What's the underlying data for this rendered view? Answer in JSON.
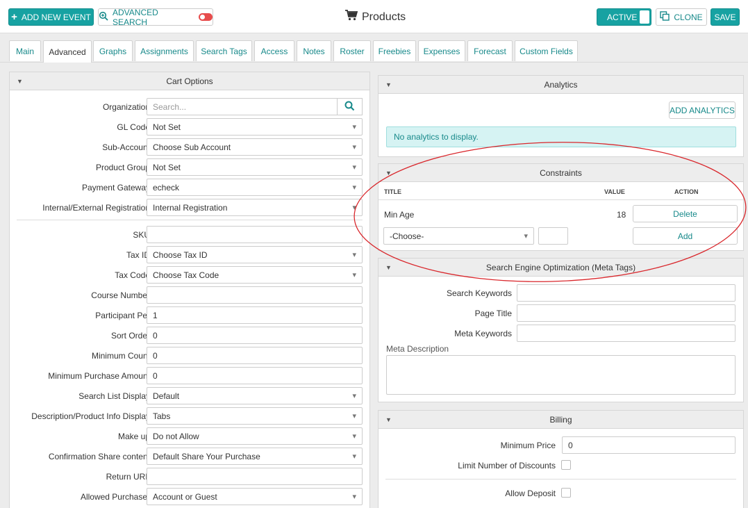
{
  "header": {
    "add_event": "ADD NEW EVENT",
    "advanced_search": "ADVANCED SEARCH",
    "title": "Products",
    "active": "ACTIVE",
    "clone": "CLONE",
    "save": "SAVE"
  },
  "tabs": [
    "Main",
    "Advanced",
    "Graphs",
    "Assignments",
    "Search Tags",
    "Access",
    "Notes",
    "Roster",
    "Freebies",
    "Expenses",
    "Forecast",
    "Custom Fields"
  ],
  "active_tab": "Advanced",
  "cart": {
    "title": "Cart Options",
    "organization_label": "Organization",
    "organization_placeholder": "Search...",
    "rows1": [
      {
        "label": "GL Code",
        "value": "Not Set",
        "type": "select"
      },
      {
        "label": "Sub-Account",
        "value": "Choose Sub Account",
        "type": "select"
      },
      {
        "label": "Product Group",
        "value": "Not Set",
        "type": "select"
      },
      {
        "label": "Payment Gateway",
        "value": "echeck",
        "type": "select"
      },
      {
        "label": "Internal/External Registration",
        "value": "Internal Registration",
        "type": "select"
      }
    ],
    "rows2": [
      {
        "label": "SKU",
        "value": "",
        "type": "text"
      },
      {
        "label": "Tax ID",
        "value": "Choose Tax ID",
        "type": "select"
      },
      {
        "label": "Tax Code",
        "value": "Choose Tax Code",
        "type": "select"
      },
      {
        "label": "Course Number",
        "value": "",
        "type": "text"
      },
      {
        "label": "Participant Per",
        "value": "1",
        "type": "text"
      },
      {
        "label": "Sort Order",
        "value": "0",
        "type": "text"
      },
      {
        "label": "Minimum Count",
        "value": "0",
        "type": "text"
      },
      {
        "label": "Minimum Purchase Amount",
        "value": "0",
        "type": "text"
      },
      {
        "label": "Search List Display",
        "value": "Default",
        "type": "select"
      },
      {
        "label": "Description/Product Info Display",
        "value": "Tabs",
        "type": "select"
      },
      {
        "label": "Make up",
        "value": "Do not Allow",
        "type": "select"
      },
      {
        "label": "Confirmation Share content",
        "value": "Default Share Your Purchase",
        "type": "select"
      },
      {
        "label": "Return URL",
        "value": "",
        "type": "text"
      },
      {
        "label": "Allowed Purchaser",
        "value": "Account or Guest",
        "type": "select"
      }
    ]
  },
  "analytics": {
    "title": "Analytics",
    "add_button": "ADD ANALYTICS",
    "empty_message": "No analytics to display."
  },
  "constraints": {
    "title": "Constraints",
    "col_title": "TITLE",
    "col_value": "VALUE",
    "col_action": "ACTION",
    "rows": [
      {
        "title": "Min Age",
        "value": "18",
        "action": "Delete"
      }
    ],
    "choose_placeholder": "-Choose-",
    "add_button": "Add"
  },
  "seo": {
    "title": "Search Engine Optimization (Meta Tags)",
    "search_keywords": "Search Keywords",
    "page_title": "Page Title",
    "meta_keywords": "Meta Keywords",
    "meta_description": "Meta Description"
  },
  "billing": {
    "title": "Billing",
    "minimum_price_label": "Minimum Price",
    "minimum_price_value": "0",
    "limit_discounts_label": "Limit Number of Discounts",
    "allow_deposit_label": "Allow Deposit"
  },
  "colors": {
    "accent": "#17a2a2",
    "annotation": "#d9262b",
    "info_bg": "#d6f3f3"
  }
}
